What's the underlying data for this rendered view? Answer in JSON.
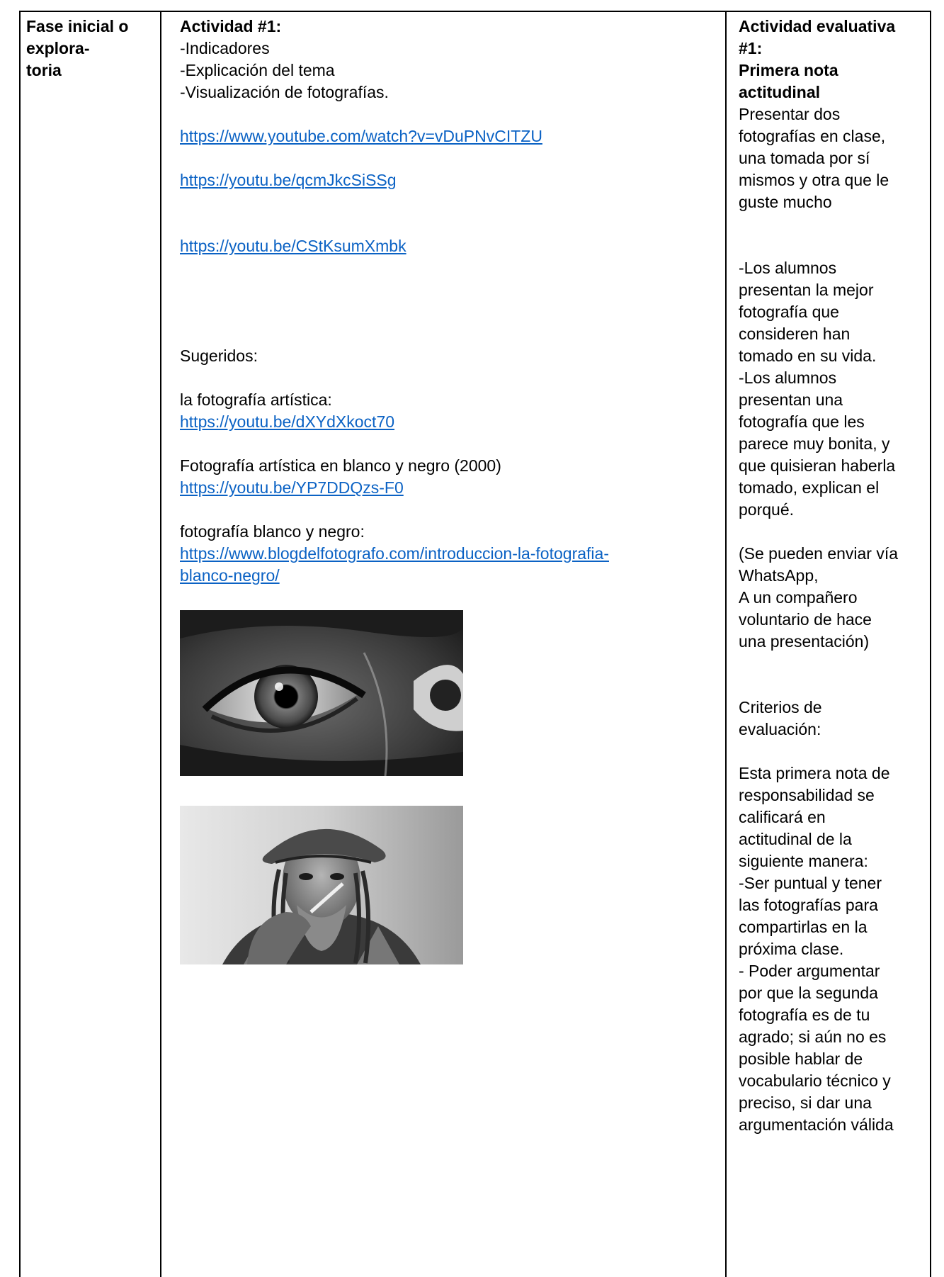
{
  "col1": {
    "phase": "Fase inicial o\nexplora-\ntoria"
  },
  "col2": {
    "title": "Actividad #1:",
    "items": [
      "-Indicadores",
      "-Explicación del tema",
      "-Visualización de fotografías."
    ],
    "links_main": [
      "https://www.youtube.com/watch?v=vDuPNvCITZU",
      "https://youtu.be/qcmJkcSiSSg",
      "https://youtu.be/CStKsumXmbk"
    ],
    "suggested_label": "Sugeridos:",
    "suggested": [
      {
        "label": "la fotografía artística:",
        "link": "https://youtu.be/dXYdXkoct70"
      },
      {
        "label": "Fotografía artística en blanco y negro (2000)",
        "link": "https://youtu.be/YP7DDQzs-F0"
      },
      {
        "label": "fotografía blanco y negro:",
        "link": "https://www.blogdelfotografo.com/introduccion-la-fotografia-\nblanco-negro/"
      }
    ]
  },
  "col3": {
    "title": "Actividad evaluativa\n#1:\nPrimera nota\nactitudinal",
    "p1": "Presentar dos\nfotografías en clase,\nuna tomada por sí\nmismos y otra que le\nguste mucho",
    "p2": "-Los alumnos\npresentan la mejor\nfotografía que\nconsideren han\ntomado en su vida.\n-Los alumnos\npresentan una\nfotografía que les\nparece muy bonita, y\nque quisieran haberla\ntomado, explican el\nporqué.",
    "p3": "(Se pueden enviar vía\nWhatsApp,\nA un compañero\nvoluntario de hace\nuna presentación)",
    "p4": "Criterios de\nevaluación:",
    "p5": "Esta primera nota de\nresponsabilidad se\ncalificará en\nactitudinal de la\nsiguiente manera:\n-Ser puntual y tener\nlas fotografías para\ncompartirlas en la\npróxima clase.\n- Poder argumentar\npor que la segunda\nfotografía es de tu\nagrado; si aún no es\nposible hablar de\nvocabulario técnico y\npreciso, si dar una\nargumentación válida"
  }
}
